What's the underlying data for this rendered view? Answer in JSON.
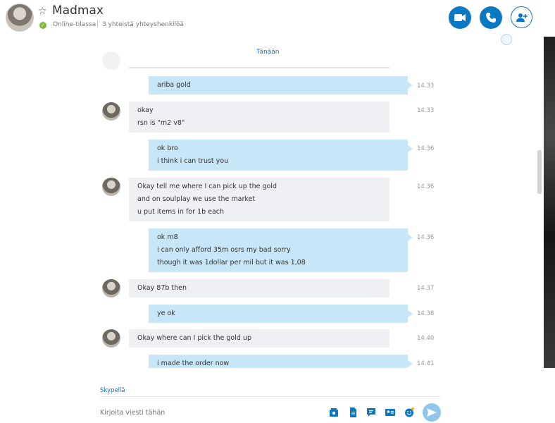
{
  "header": {
    "name": "Madmax",
    "status": "Online-tilassa",
    "separator": "|",
    "contacts": "3 yhteistä yhteyshenkilöä",
    "star_icon": "star-outline-icon",
    "status_icon": "check-circle-icon",
    "buttons": [
      "video-call-icon",
      "audio-call-icon",
      "add-contact-icon"
    ],
    "accent": "#0a78c2"
  },
  "chat": {
    "date_label": "Tänään",
    "messages": [
      {
        "dir": "out",
        "time": "14.33",
        "lines": [
          "ariba gold"
        ]
      },
      {
        "dir": "in",
        "time": "14.33",
        "lines": [
          "okay",
          "rsn is \"m2 v8\""
        ]
      },
      {
        "dir": "out",
        "time": "14.36",
        "lines": [
          "ok bro",
          "i think i can trust you"
        ]
      },
      {
        "dir": "in",
        "time": "14.36",
        "lines": [
          "Okay tell me where I can pick up the gold",
          "and on soulplay we use the market",
          "u put items in for 1b each"
        ]
      },
      {
        "dir": "out",
        "time": "14.36",
        "lines": [
          "ok m8",
          "i can only afford 35m osrs my bad sorry",
          "though it was 1dollar per mil but it was 1,08"
        ]
      },
      {
        "dir": "in",
        "time": "14.37",
        "lines": [
          "Okay 87b then"
        ]
      },
      {
        "dir": "out",
        "time": "14.38",
        "lines": [
          "ye ok"
        ]
      },
      {
        "dir": "in",
        "time": "14.40",
        "lines": [
          "Okay where can I pick the gold up"
        ]
      },
      {
        "dir": "out",
        "time": "14.41",
        "lines": [
          "i made the order now"
        ]
      }
    ],
    "out_bubble_color": "#c7e6f8",
    "in_bubble_color": "#eef0f4"
  },
  "composer": {
    "mode": "Skypellä",
    "placeholder": "Kirjoita viesti tähän",
    "tools": [
      "media-gallery-icon",
      "file-icon",
      "video-message-icon",
      "contact-card-icon",
      "emoticon-icon"
    ],
    "send_icon": "send-icon"
  }
}
